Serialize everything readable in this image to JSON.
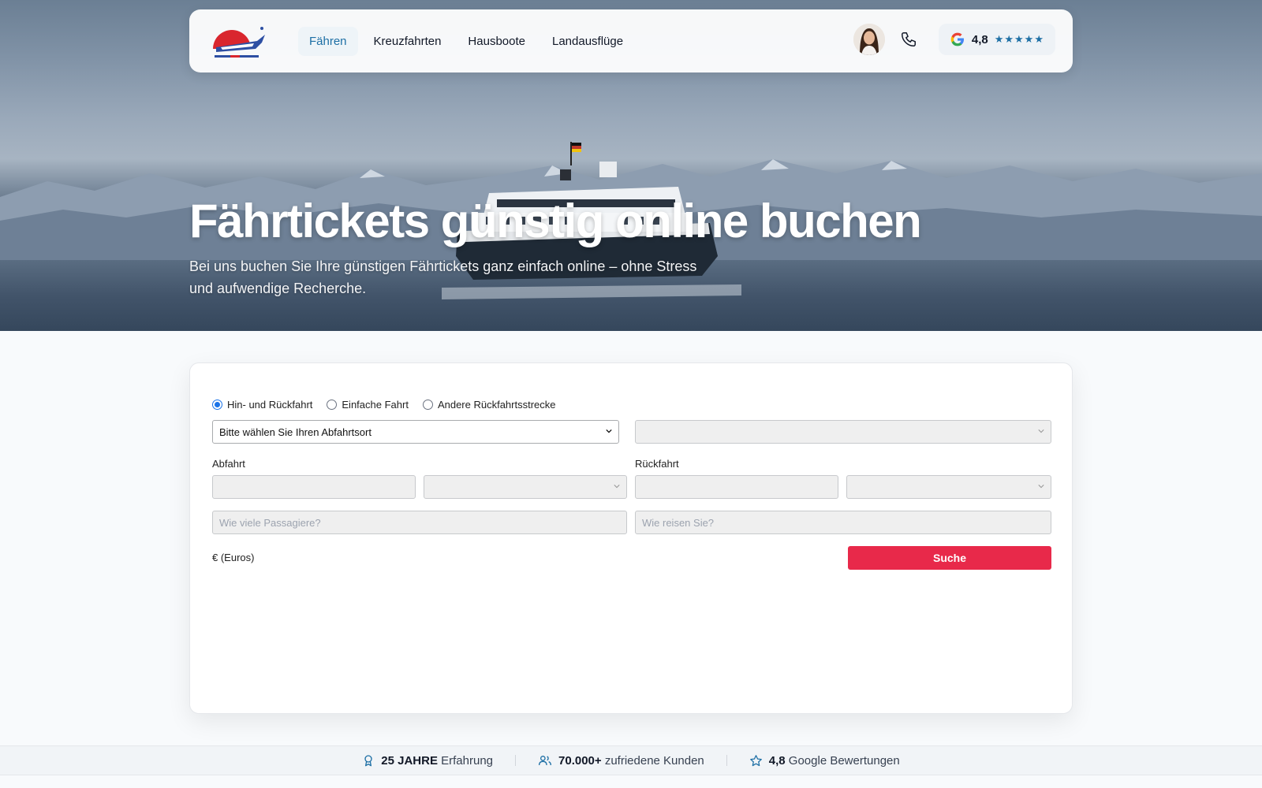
{
  "header": {
    "logo_icon": "ocean24-ship-logo",
    "nav": [
      {
        "label": "Fähren",
        "active": true
      },
      {
        "label": "Kreuzfahrten",
        "active": false
      },
      {
        "label": "Hausboote",
        "active": false
      },
      {
        "label": "Landausflüge",
        "active": false
      }
    ],
    "phone_icon": "phone-icon",
    "rating": {
      "value": "4,8",
      "stars": "★★★★★",
      "icon": "google-icon"
    }
  },
  "hero": {
    "title": "Fährtickets günstig online buchen",
    "subtitle": "Bei uns buchen Sie Ihre günstigen Fährtickets ganz einfach online – ohne Stress und aufwendige Recherche."
  },
  "booking": {
    "trip_types": [
      {
        "label": "Hin- und Rückfahrt",
        "checked": true
      },
      {
        "label": "Einfache Fahrt",
        "checked": false
      },
      {
        "label": "Andere Rückfahrtsstrecke",
        "checked": false
      }
    ],
    "departure_port_placeholder": "Bitte wählen Sie Ihren Abfahrtsort",
    "destination_port_value": "",
    "departure_label": "Abfahrt",
    "return_label": "Rückfahrt",
    "passengers_placeholder": "Wie viele Passagiere?",
    "vehicle_placeholder": "Wie reisen Sie?",
    "currency": "€ (Euros)",
    "search_label": "Suche"
  },
  "trust": [
    {
      "icon": "award-icon",
      "strong": "25 JAHRE",
      "text": "Erfahrung"
    },
    {
      "icon": "users-icon",
      "strong": "70.000+",
      "text": "zufriedene Kunden"
    },
    {
      "icon": "star-icon",
      "strong": "4,8",
      "text": "Google Bewertungen"
    }
  ],
  "colors": {
    "accent": "#1d6fa5",
    "cta": "#e8294a"
  }
}
